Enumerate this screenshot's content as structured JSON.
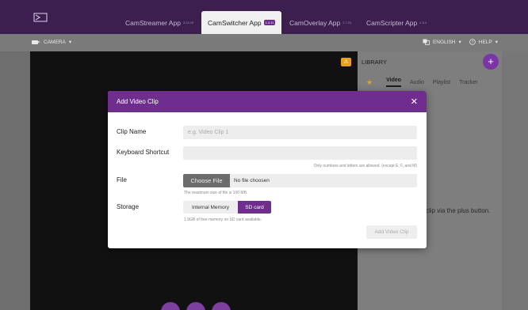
{
  "header": {
    "tabs": [
      {
        "label": "CamStreamer App",
        "version": "3.14.19"
      },
      {
        "label": "CamSwitcher App",
        "version": "1.4.11"
      },
      {
        "label": "CamOverlay App",
        "version": "2.7.21"
      },
      {
        "label": "CamScripter App",
        "version": "1.3.4"
      }
    ],
    "active_tab": "CamSwitcher App"
  },
  "toolbar": {
    "camera_label": "CAMERA",
    "language_label": "ENGLISH",
    "help_label": "HELP"
  },
  "library": {
    "title": "LIBRARY",
    "add_label": "+",
    "tabs": [
      "Video",
      "Audio",
      "Playlist",
      "Tracker"
    ],
    "active_tab": "Video",
    "empty_text": "clip via the plus button."
  },
  "modal": {
    "title": "Add Video Clip",
    "close_label": "✕",
    "clip_name_label": "Clip Name",
    "clip_name_placeholder": "e.g. Video Clip 1",
    "shortcut_label": "Keyboard Shortcut",
    "shortcut_hint": "Only numbers and letters are allowed. (except E, F, and M)",
    "file_label": "File",
    "choose_file_label": "Choose File",
    "no_file_text": "No file choosen",
    "file_hint": "The maximum size of file is 100 MB.",
    "storage_label": "Storage",
    "storage_options": [
      "Internal Memory",
      "SD card"
    ],
    "storage_selected": "SD card",
    "storage_hint": "1.9GB of free memory on SD card available.",
    "add_button_label": "Add Video Clip"
  },
  "warning_label": "⚠",
  "colors": {
    "brand": "#6f2e8e",
    "header_bg": "#3c1f4f",
    "warning": "#e4a11b",
    "star": "#e1a524"
  }
}
